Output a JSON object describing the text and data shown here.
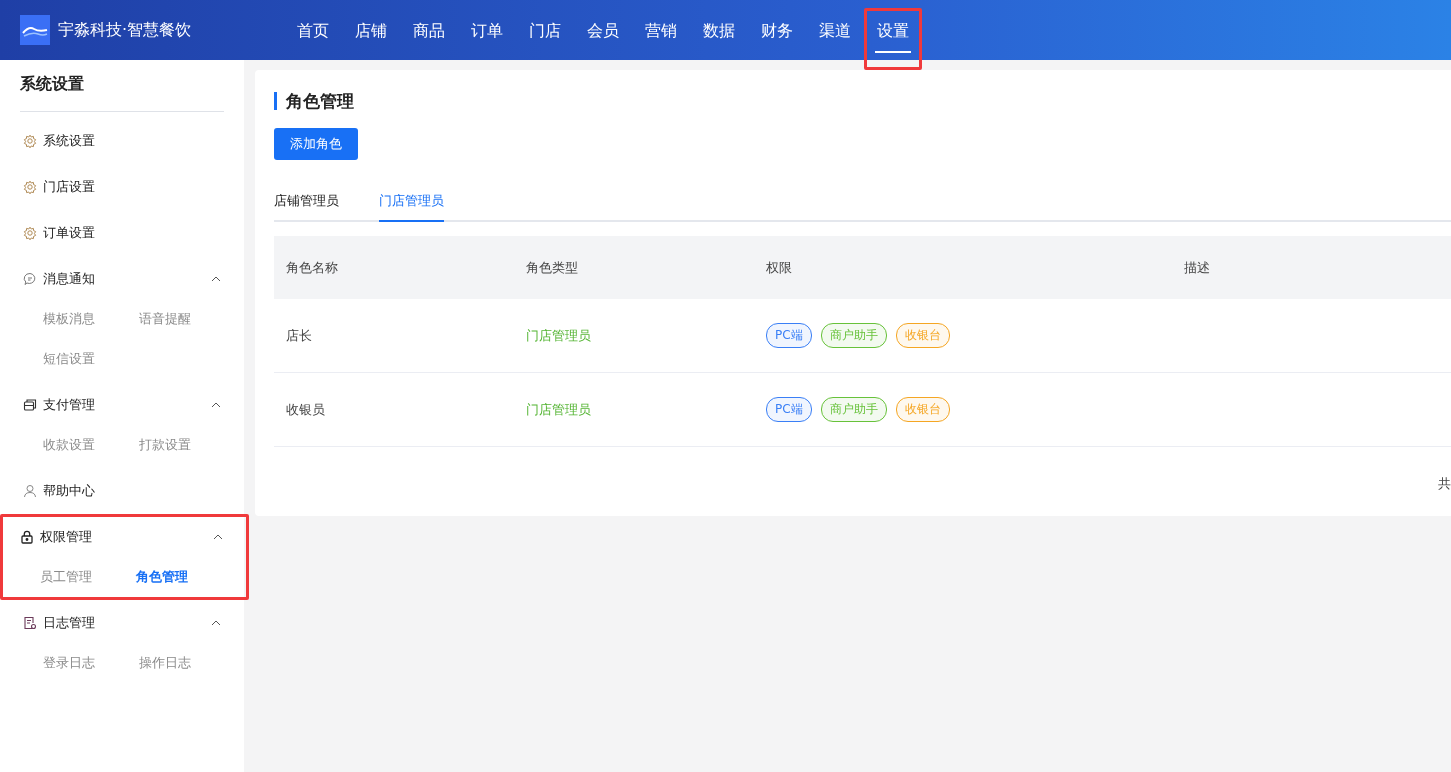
{
  "header": {
    "brand": "宇淼科技·智慧餐饮",
    "nav": [
      {
        "label": "首页",
        "selected": false,
        "highlighted": false
      },
      {
        "label": "店铺",
        "selected": false,
        "highlighted": false
      },
      {
        "label": "商品",
        "selected": false,
        "highlighted": false
      },
      {
        "label": "订单",
        "selected": false,
        "highlighted": false
      },
      {
        "label": "门店",
        "selected": false,
        "highlighted": false
      },
      {
        "label": "会员",
        "selected": false,
        "highlighted": false
      },
      {
        "label": "营销",
        "selected": false,
        "highlighted": false
      },
      {
        "label": "数据",
        "selected": false,
        "highlighted": false
      },
      {
        "label": "财务",
        "selected": false,
        "highlighted": false
      },
      {
        "label": "渠道",
        "selected": false,
        "highlighted": false
      },
      {
        "label": "设置",
        "selected": true,
        "highlighted": true
      }
    ]
  },
  "sidebar": {
    "title": "系统设置",
    "items": [
      {
        "label": "系统设置",
        "highlighted": false
      },
      {
        "label": "门店设置",
        "highlighted": false
      },
      {
        "label": "订单设置",
        "highlighted": false
      },
      {
        "label": "消息通知",
        "expanded": true,
        "highlighted": false,
        "children": [
          {
            "label": "模板消息",
            "selected": false
          },
          {
            "label": "语音提醒",
            "selected": false
          },
          {
            "label": "短信设置",
            "selected": false
          }
        ]
      },
      {
        "label": "支付管理",
        "expanded": true,
        "highlighted": false,
        "children": [
          {
            "label": "收款设置",
            "selected": false
          },
          {
            "label": "打款设置",
            "selected": false
          }
        ]
      },
      {
        "label": "帮助中心",
        "highlighted": false
      },
      {
        "label": "权限管理",
        "expanded": true,
        "highlighted": true,
        "children": [
          {
            "label": "员工管理",
            "selected": false
          },
          {
            "label": "角色管理",
            "selected": true
          }
        ]
      },
      {
        "label": "日志管理",
        "expanded": true,
        "highlighted": false,
        "children": [
          {
            "label": "登录日志",
            "selected": false
          },
          {
            "label": "操作日志",
            "selected": false
          }
        ]
      }
    ]
  },
  "main": {
    "title": "角色管理",
    "add_button": "添加角色",
    "tabs": [
      {
        "label": "店铺管理员",
        "selected": false
      },
      {
        "label": "门店管理员",
        "selected": true
      }
    ],
    "table": {
      "columns": [
        "角色名称",
        "角色类型",
        "权限",
        "描述"
      ],
      "rows": [
        {
          "name": "店长",
          "type": "门店管理员",
          "permissions": [
            {
              "label": "PC端",
              "color": "#3a7ff6"
            },
            {
              "label": "商户助手",
              "color": "#67c23a"
            },
            {
              "label": "收银台",
              "color": "#f5a623"
            }
          ]
        },
        {
          "name": "收银员",
          "type": "门店管理员",
          "permissions": [
            {
              "label": "PC端",
              "color": "#3a7ff6"
            },
            {
              "label": "商户助手",
              "color": "#67c23a"
            },
            {
              "label": "收银台",
              "color": "#f5a623"
            }
          ]
        }
      ]
    },
    "pagination": "共"
  }
}
